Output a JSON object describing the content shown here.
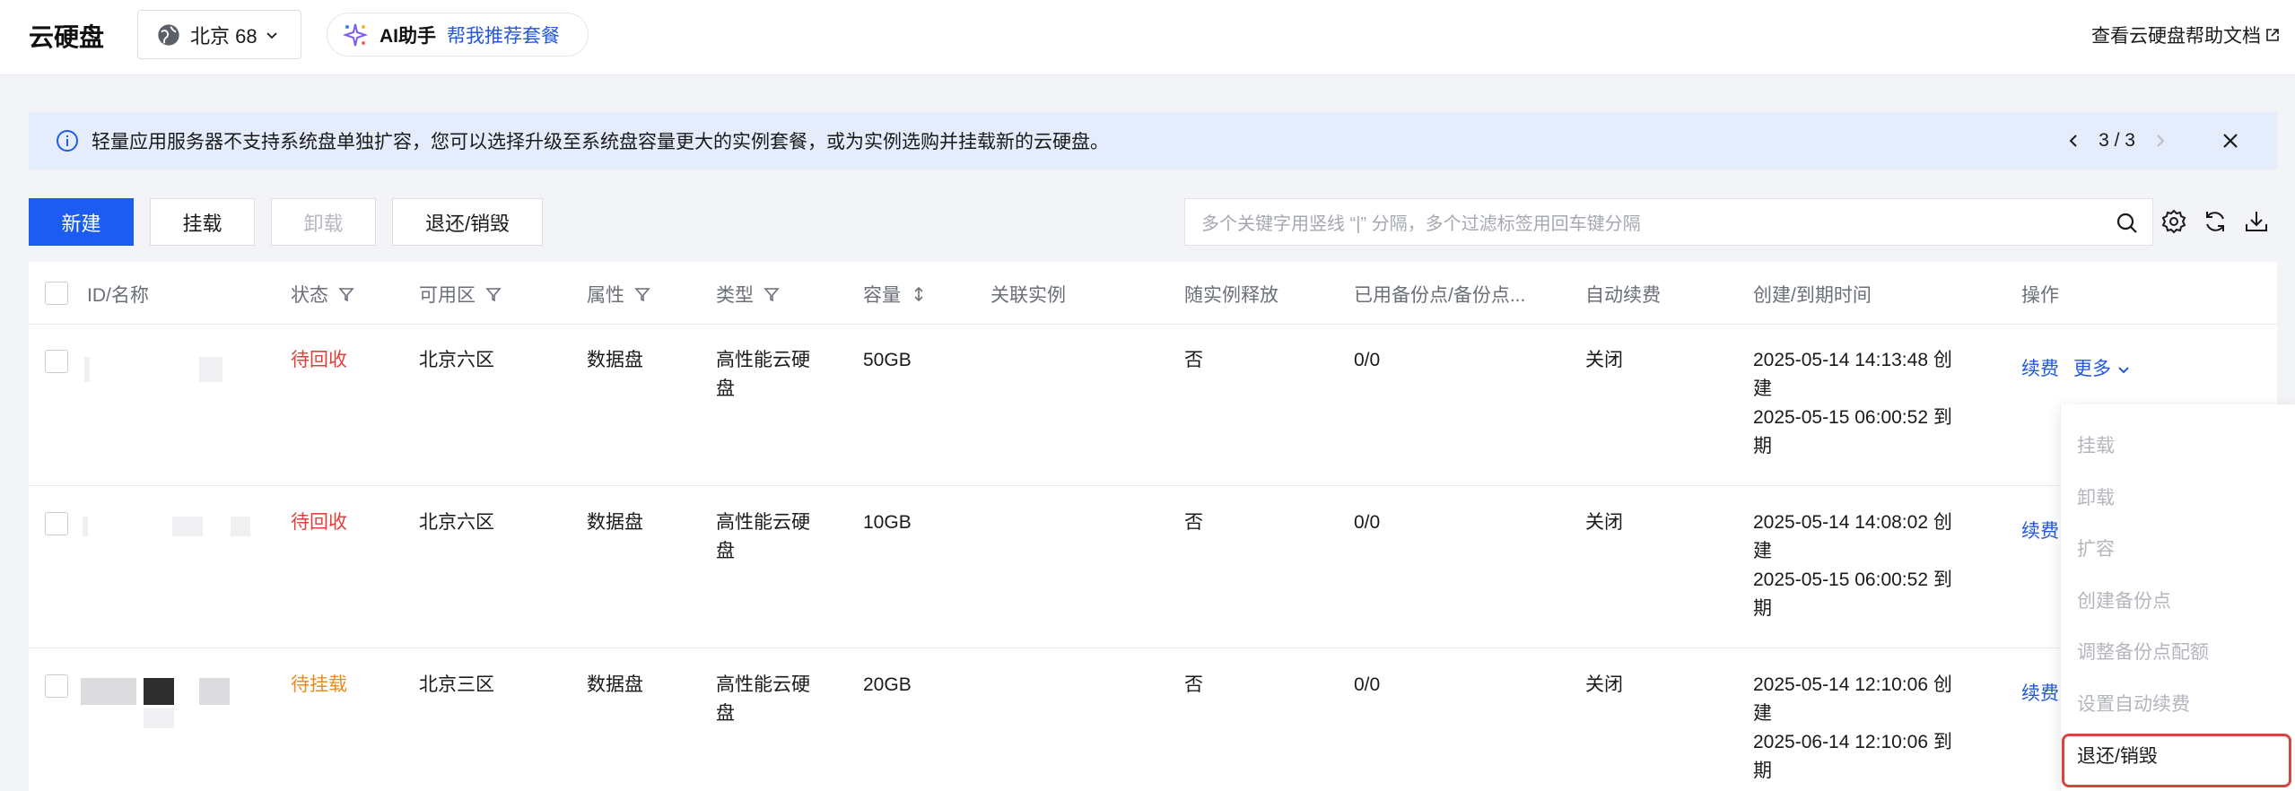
{
  "header": {
    "title": "云硬盘",
    "region": "北京 68",
    "ai_name": "AI助手",
    "ai_link": "帮我推荐套餐",
    "help_link": "查看云硬盘帮助文档"
  },
  "notice": {
    "text": "轻量应用服务器不支持系统盘单独扩容，您可以选择升级至系统盘容量更大的实例套餐，或为实例选购并挂载新的云硬盘。",
    "page": "3 / 3"
  },
  "toolbar": {
    "new_label": "新建",
    "mount_label": "挂载",
    "unmount_label": "卸载",
    "return_label": "退还/销毁",
    "search_placeholder": "多个关键字用竖线 “|” 分隔，多个过滤标签用回车键分隔"
  },
  "table": {
    "columns": {
      "id_name": "ID/名称",
      "status": "状态",
      "zone": "可用区",
      "attribute": "属性",
      "type": "类型",
      "capacity": "容量",
      "instance": "关联实例",
      "release": "随实例释放",
      "backup": "已用备份点/备份点...",
      "auto_renew": "自动续费",
      "time": "创建/到期时间",
      "actions": "操作"
    },
    "rows": [
      {
        "status": "待回收",
        "zone": "北京六区",
        "attribute": "数据盘",
        "type_line1": "高性能云硬",
        "type_line2": "盘",
        "capacity": "50GB",
        "release": "否",
        "backup": "0/0",
        "auto_renew": "关闭",
        "time1": "2025-05-14 14:13:48 创",
        "time2": "建",
        "time3": "2025-05-15 06:00:52 到",
        "time4": "期",
        "renew": "续费",
        "more": "更多"
      },
      {
        "status": "待回收",
        "zone": "北京六区",
        "attribute": "数据盘",
        "type_line1": "高性能云硬",
        "type_line2": "盘",
        "capacity": "10GB",
        "release": "否",
        "backup": "0/0",
        "auto_renew": "关闭",
        "time1": "2025-05-14 14:08:02 创",
        "time2": "建",
        "time3": "2025-05-15 06:00:52 到",
        "time4": "期",
        "renew": "续费"
      },
      {
        "status": "待挂载",
        "zone": "北京三区",
        "attribute": "数据盘",
        "type_line1": "高性能云硬",
        "type_line2": "盘",
        "capacity": "20GB",
        "release": "否",
        "backup": "0/0",
        "auto_renew": "关闭",
        "time1": "2025-05-14 12:10:06 创",
        "time2": "建",
        "time3": "2025-06-14 12:10:06 到",
        "time4": "期",
        "renew": "续费"
      }
    ]
  },
  "dropdown": {
    "items": [
      "挂载",
      "卸载",
      "扩容",
      "创建备份点",
      "调整备份点配额",
      "设置自动续费",
      "退还/销毁"
    ]
  },
  "colors": {
    "primary": "#1c5cf0",
    "link": "#2357e0",
    "status_recycle": "#e1403a",
    "status_unmounted": "#ee8a1a",
    "highlight": "#d9453d"
  }
}
